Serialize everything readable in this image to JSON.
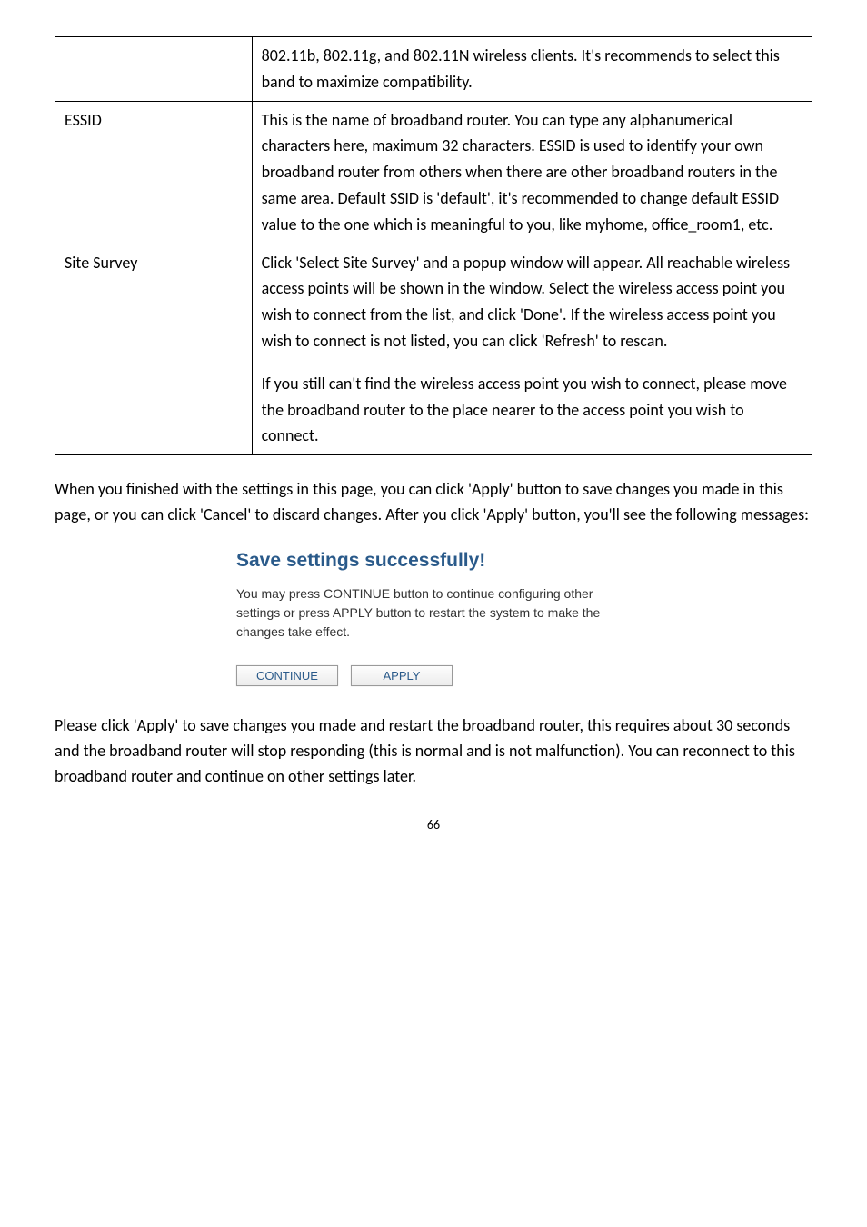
{
  "table": {
    "row0_left": "",
    "row0_right": "802.11b, 802.11g, and 802.11N wireless clients. It's recommends to select this band to maximize compatibility.",
    "row1_left": "ESSID",
    "row1_right": "This is the name of broadband router. You can type any alphanumerical characters here, maximum 32 characters. ESSID is used to identify your own broadband router from others when there are other broadband routers in the same area. Default SSID is 'default', it's recommended to change default ESSID value to the one which is meaningful to you, like myhome, office_room1, etc.",
    "row2_left": "Site Survey",
    "row2_right_p1": "Click 'Select Site Survey' and a popup window will appear. All reachable wireless access points will be shown in the window. Select the wireless access point you wish to connect from the list, and click 'Done'. If the wireless access point you wish to connect is not listed, you can click 'Refresh' to rescan.",
    "row2_right_p2": "If you still can't find the wireless access point you wish to connect, please move the broadband router to the place nearer to the access point you wish to connect."
  },
  "para1": "When you finished with the settings in this page, you can click 'Apply' button to save changes you made in this page, or you can click 'Cancel' to discard changes. After you click 'Apply' button, you'll see the following messages:",
  "save": {
    "heading": "Save settings successfully!",
    "desc": "You may press CONTINUE button to continue configuring other settings or press APPLY button to restart the system to make the changes take effect.",
    "btn_continue": "CONTINUE",
    "btn_apply": "APPLY"
  },
  "para2": "Please click 'Apply' to save changes you made and restart the broadband router, this requires about 30 seconds and the broadband router will stop responding (this is normal and is not malfunction). You can reconnect to this broadband router and continue on other settings later.",
  "page_number": "66"
}
